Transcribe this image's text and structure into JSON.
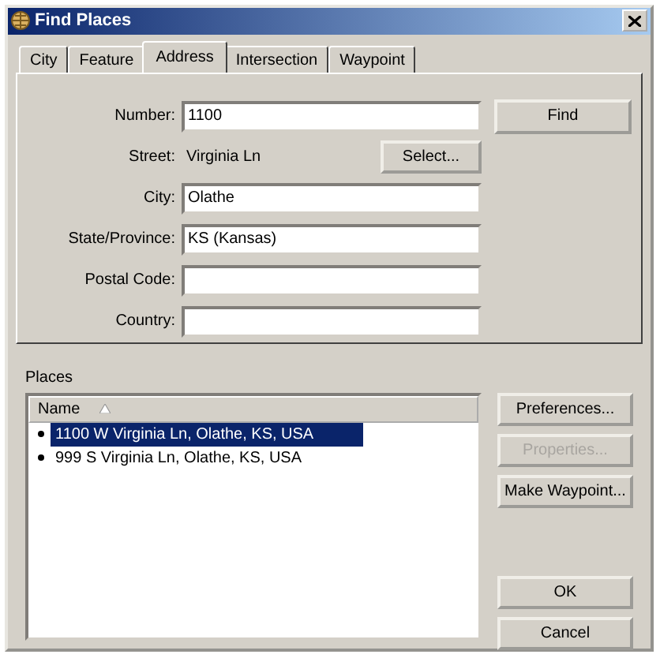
{
  "window": {
    "title": "Find Places"
  },
  "tabs": [
    {
      "label": "City",
      "selected": false
    },
    {
      "label": "Feature",
      "selected": false
    },
    {
      "label": "Address",
      "selected": true
    },
    {
      "label": "Intersection",
      "selected": false
    },
    {
      "label": "Waypoint",
      "selected": false
    }
  ],
  "fields": [
    {
      "kind": "input",
      "label": "Number:",
      "value": "1100"
    },
    {
      "kind": "static",
      "label": "Street:",
      "value": "Virginia Ln",
      "button": "Select..."
    },
    {
      "kind": "input",
      "label": "City:",
      "value": "Olathe"
    },
    {
      "kind": "input",
      "label": "State/Province:",
      "value": "KS (Kansas)"
    },
    {
      "kind": "input",
      "label": "Postal Code:"
    },
    {
      "kind": "input",
      "label": "Country:"
    }
  ],
  "find_button": "Find",
  "places": {
    "label": "Places",
    "column": "Name",
    "rows": [
      {
        "text": "1100 W Virginia Ln, Olathe, KS, USA",
        "selected": true
      },
      {
        "text": "999 S Virginia Ln, Olathe, KS, USA",
        "selected": false
      }
    ]
  },
  "side_buttons": [
    {
      "label": "Preferences...",
      "disabled": false
    },
    {
      "label": "Properties...",
      "disabled": true
    },
    {
      "label": "Make Waypoint...",
      "disabled": false
    }
  ],
  "dialog_buttons": [
    "OK",
    "Cancel"
  ]
}
